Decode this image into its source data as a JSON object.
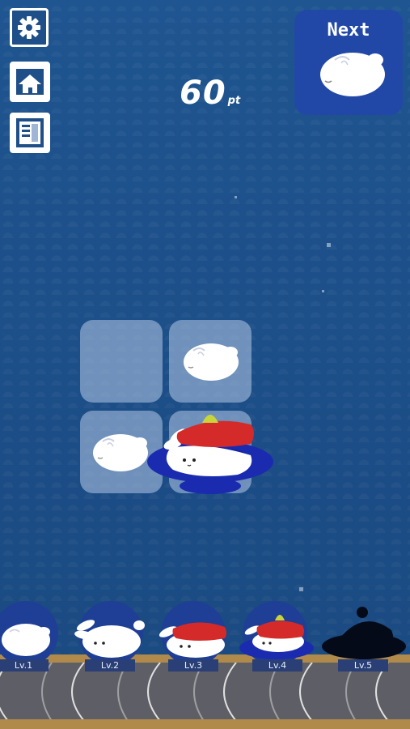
{
  "score": {
    "value": "60",
    "unit": "pt"
  },
  "next": {
    "label": "Next"
  },
  "side_buttons": [
    {
      "name": "settings-button",
      "icon": "gear-icon"
    },
    {
      "name": "home-button",
      "icon": "home-icon"
    },
    {
      "name": "book-button",
      "icon": "book-icon"
    }
  ],
  "levels": [
    {
      "label": "Lv.1"
    },
    {
      "label": "Lv.2"
    },
    {
      "label": "Lv.3"
    },
    {
      "label": "Lv.4"
    },
    {
      "label": "Lv.5"
    }
  ],
  "colors": {
    "background": "#1d4f8a",
    "next_panel": "#2248a7",
    "cell": "#b4c8e6",
    "tuna": "#d52a2a",
    "plate": "#1a2bb0",
    "wasabi": "#c8d43a",
    "belt": "#5e5e66",
    "rail": "#b08a4b"
  }
}
